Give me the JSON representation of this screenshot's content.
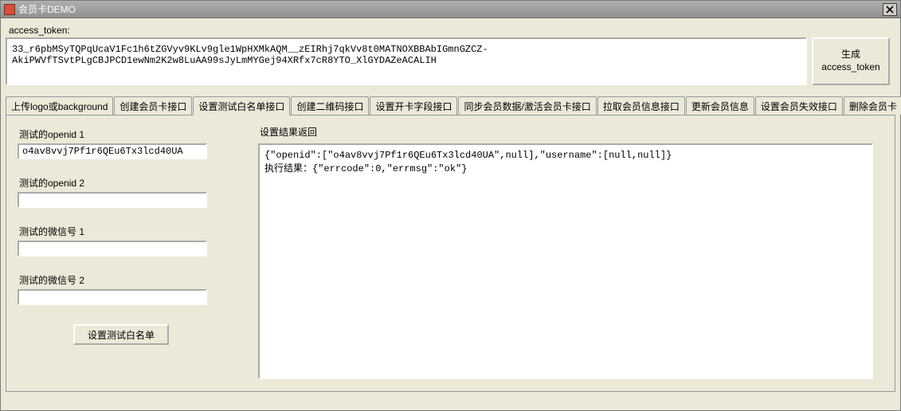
{
  "window": {
    "title": "会员卡DEMO",
    "close_icon": "close-icon"
  },
  "at": {
    "label": "access_token:",
    "value": "33_r6pbMSyTQPqUcaV1Fc1h6tZGVyv9KLv9gle1WpHXMkAQM__zEIRhj7qkVv8t0MATNOXBBAbIGmnGZCZ-AkiPWVfTSvtPLgCBJPCD1ewNm2K2w8LuAA99sJyLmMYGej94XRfx7cR8YTO_XlGYDAZeACALIH",
    "gen_btn": "生成\naccess_token"
  },
  "tabs": [
    "上传logo或background",
    "创建会员卡接口",
    "设置测试白名单接口",
    "创建二维码接口",
    "设置开卡字段接口",
    "同步会员数据/激活会员卡接口",
    "拉取会员信息接口",
    "更新会员信息",
    "设置会员失效接口",
    "删除会员卡"
  ],
  "active_tab_index": 2,
  "form": {
    "openid1_label": "测试的openid 1",
    "openid1_value": "o4av8vvj7Pf1r6QEu6Tx3lcd40UA",
    "openid2_label": "测试的openid 2",
    "openid2_value": "",
    "wx1_label": "测试的微信号 1",
    "wx1_value": "",
    "wx2_label": "测试的微信号 2",
    "wx2_value": "",
    "run_btn": "设置测试白名单"
  },
  "result": {
    "label": "设置结果返回",
    "text": "{\"openid\":[\"o4av8vvj7Pf1r6QEu6Tx3lcd40UA\",null],\"username\":[null,null]}\n执行结果：{\"errcode\":0,\"errmsg\":\"ok\"}"
  }
}
